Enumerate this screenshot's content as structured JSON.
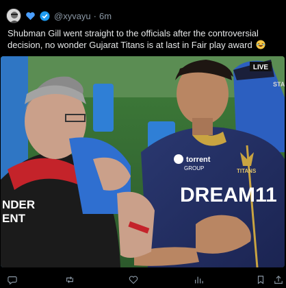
{
  "tweet": {
    "handle": "@xyvayu",
    "separator": "·",
    "time": "6m",
    "text": "Shubman Gill went straight to the officials after the controversial decision, no wonder Gujarat Titans is at last in Fair play award",
    "emoji": "laughing-emoji"
  },
  "media": {
    "live_label": "LIVE",
    "live_sub": "STA",
    "jersey_sponsor": "DREAM11",
    "jersey_brand": "torrent",
    "jersey_brand_sub": "GROUP",
    "jersey_crest": "TITANS",
    "official_shirt_line1": "NDER",
    "official_shirt_line2": "ENT"
  },
  "colors": {
    "verified_blue": "#1d9bf0",
    "heart_blue": "#4a9eff",
    "muted": "#8b98a5"
  },
  "icons": {
    "reply": "reply-icon",
    "retweet": "retweet-icon",
    "like": "heart-icon",
    "views": "views-icon",
    "bookmark": "bookmark-icon",
    "share": "share-icon"
  }
}
